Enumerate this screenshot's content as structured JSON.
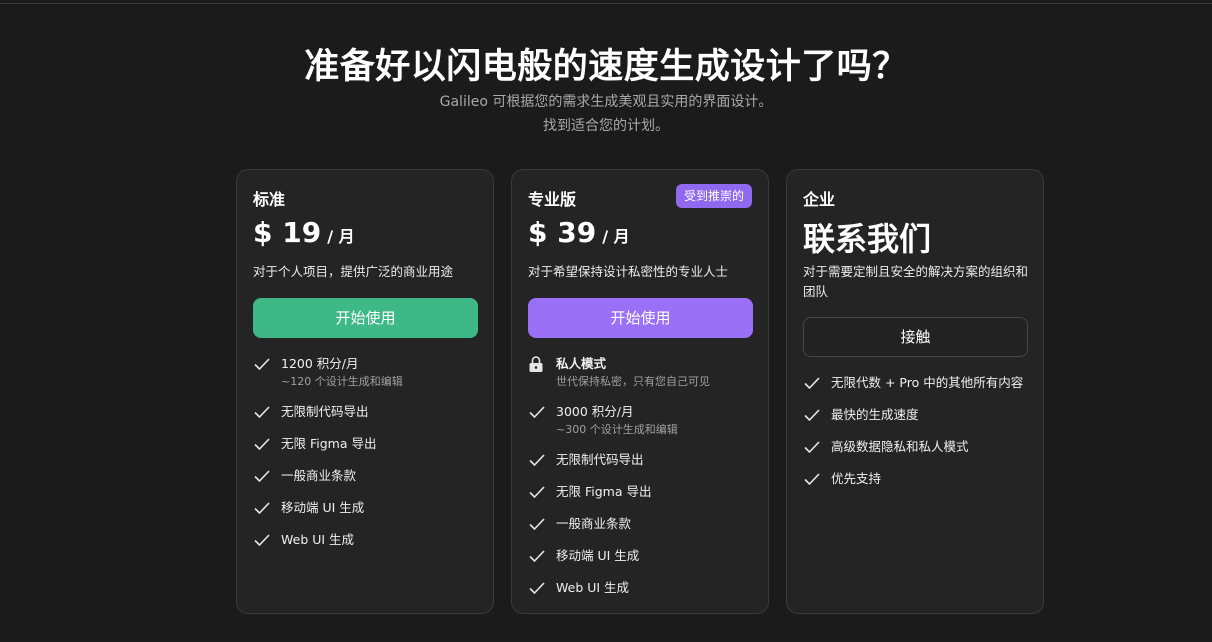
{
  "hero": {
    "title": "准备好以闪电般的速度生成设计了吗？",
    "subtitle_line1": "Galileo 可根据您的需求生成美观且实用的界面设计。",
    "subtitle_line2": "找到适合您的计划。"
  },
  "plans": [
    {
      "name": "标准",
      "price": "$ 19",
      "period": "/ 月",
      "description": "对于个人项目，提供广泛的商业用途",
      "button": "开始使用",
      "features": [
        {
          "text": "1200 积分/月",
          "sub": "~120 个设计生成和编辑",
          "icon": "check-icon"
        },
        {
          "text": "无限制代码导出",
          "icon": "check-icon"
        },
        {
          "text": "无限 Figma 导出",
          "icon": "check-icon"
        },
        {
          "text": "一般商业条款",
          "icon": "check-icon"
        },
        {
          "text": "移动端 UI 生成",
          "icon": "check-icon"
        },
        {
          "text": "Web UI 生成",
          "icon": "check-icon"
        }
      ]
    },
    {
      "name": "专业版",
      "badge": "受到推崇的",
      "price": "$ 39",
      "period": "/ 月",
      "description": "对于希望保持设计私密性的专业人士",
      "button": "开始使用",
      "features": [
        {
          "text": "私人模式",
          "sub": "世代保持私密，只有您自己可见",
          "icon": "lock-icon"
        },
        {
          "text": "3000 积分/月",
          "sub": "~300 个设计生成和编辑",
          "icon": "check-icon"
        },
        {
          "text": "无限制代码导出",
          "icon": "check-icon"
        },
        {
          "text": "无限 Figma 导出",
          "icon": "check-icon"
        },
        {
          "text": "一般商业条款",
          "icon": "check-icon"
        },
        {
          "text": "移动端 UI 生成",
          "icon": "check-icon"
        },
        {
          "text": "Web UI 生成",
          "icon": "check-icon"
        }
      ]
    },
    {
      "name": "企业",
      "contact_title": "联系我们",
      "description": "对于需要定制且安全的解决方案的组织和团队",
      "button": "接触",
      "features": [
        {
          "text": "无限代数 + Pro 中的其他所有内容",
          "icon": "check-icon"
        },
        {
          "text": "最快的生成速度",
          "icon": "check-icon"
        },
        {
          "text": "高级数据隐私和私人模式",
          "icon": "check-icon"
        },
        {
          "text": "优先支持",
          "icon": "check-icon"
        }
      ]
    }
  ],
  "colors": {
    "background": "#1b1b1b",
    "card": "#242424",
    "green_button": "#3fb887",
    "purple_button": "#9a70f7",
    "badge": "#8f69f0"
  }
}
